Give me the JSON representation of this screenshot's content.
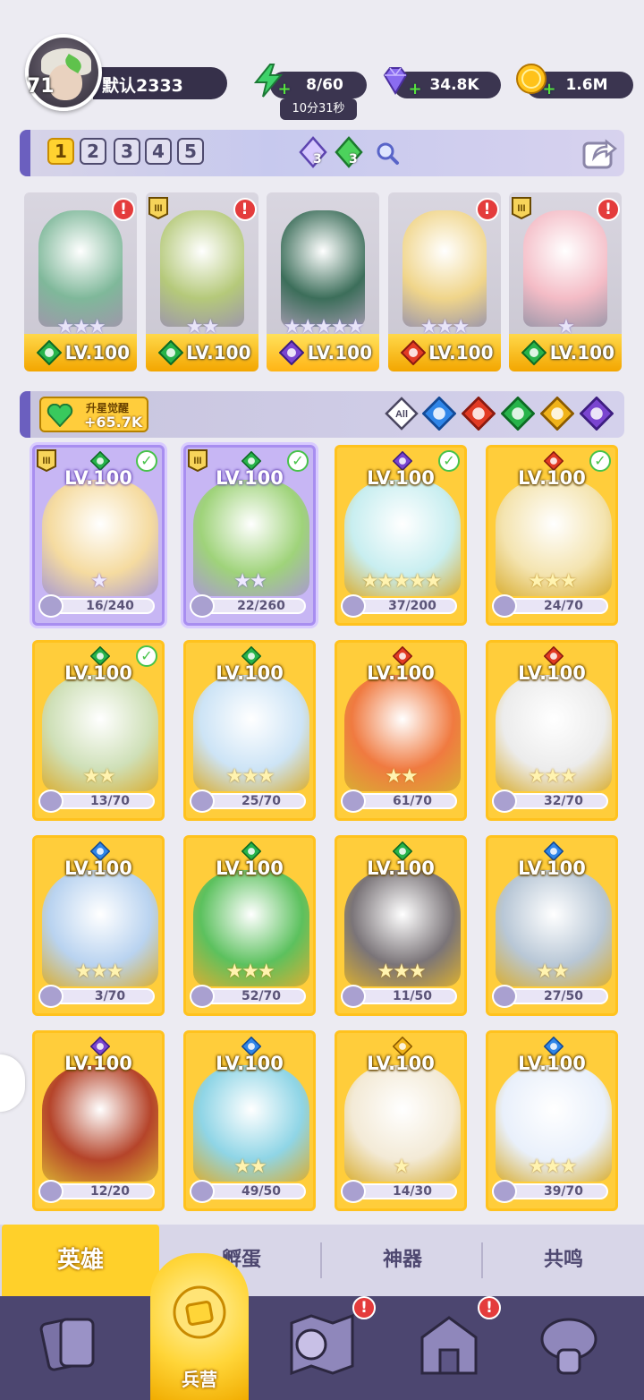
{
  "player": {
    "level": "71",
    "name": "默认2333"
  },
  "resources": {
    "energy": "8/60",
    "energy_timer": "10分31秒",
    "gems": "34.8K",
    "coins": "1.6M"
  },
  "team": {
    "slots": [
      "1",
      "2",
      "3",
      "4",
      "5"
    ],
    "active_slot": "1",
    "gem_counts": [
      "3",
      "3"
    ],
    "members": [
      {
        "level": "LV.100",
        "element": "nature",
        "stars": "★★★",
        "alert": "!"
      },
      {
        "level": "LV.100",
        "element": "nature",
        "stars": "★★",
        "alert": "!",
        "tier": "III"
      },
      {
        "level": "LV.100",
        "element": "dark",
        "stars": "★★★★★"
      },
      {
        "level": "LV.100",
        "element": "fire",
        "stars": "★★★",
        "alert": "!"
      },
      {
        "level": "LV.100",
        "element": "nature",
        "stars": "★",
        "alert": "!",
        "tier": "III"
      }
    ]
  },
  "awaken": {
    "label": "升星觉醒",
    "value": "+65.7K"
  },
  "filters": [
    "All",
    "water",
    "fire",
    "nature",
    "light",
    "dark"
  ],
  "heroes": [
    {
      "level": "LV.100",
      "progress": "16/240",
      "element": "nature",
      "stars": "★",
      "purple": true,
      "checked": true,
      "tier": "III"
    },
    {
      "level": "LV.100",
      "progress": "22/260",
      "element": "nature",
      "stars": "★★",
      "purple": true,
      "checked": true,
      "tier": "III"
    },
    {
      "level": "LV.100",
      "progress": "37/200",
      "element": "dark",
      "stars": "★★★★★",
      "checked": true
    },
    {
      "level": "LV.100",
      "progress": "24/70",
      "element": "fire",
      "stars": "★★★",
      "checked": true
    },
    {
      "level": "LV.100",
      "progress": "13/70",
      "element": "nature",
      "stars": "★★",
      "checked": true
    },
    {
      "level": "LV.100",
      "progress": "25/70",
      "element": "nature",
      "stars": "★★★"
    },
    {
      "level": "LV.100",
      "progress": "61/70",
      "element": "fire",
      "stars": "★★"
    },
    {
      "level": "LV.100",
      "progress": "32/70",
      "element": "fire",
      "stars": "★★★"
    },
    {
      "level": "LV.100",
      "progress": "3/70",
      "element": "water",
      "stars": "★★★"
    },
    {
      "level": "LV.100",
      "progress": "52/70",
      "element": "nature",
      "stars": "★★★"
    },
    {
      "level": "LV.100",
      "progress": "11/50",
      "element": "nature",
      "stars": "★★★"
    },
    {
      "level": "LV.100",
      "progress": "27/50",
      "element": "water",
      "stars": "★★"
    },
    {
      "level": "LV.100",
      "progress": "12/20",
      "element": "dark",
      "stars": ""
    },
    {
      "level": "LV.100",
      "progress": "49/50",
      "element": "water",
      "stars": "★★"
    },
    {
      "level": "LV.100",
      "progress": "14/30",
      "element": "light",
      "stars": "★"
    },
    {
      "level": "LV.100",
      "progress": "39/70",
      "element": "water",
      "stars": "★★★"
    }
  ],
  "tabs": [
    "英雄",
    "孵蛋",
    "神器",
    "共鸣"
  ],
  "nav": {
    "active_label": "兵营",
    "alerts": [
      "!",
      "!"
    ]
  },
  "colors": {
    "gold": "#ffcd3b",
    "purple": "#c7b6f4",
    "nature": "#27b34a",
    "fire": "#e23b24",
    "water": "#2f86e8",
    "dark": "#7a45d0",
    "light": "#f0b31a"
  }
}
